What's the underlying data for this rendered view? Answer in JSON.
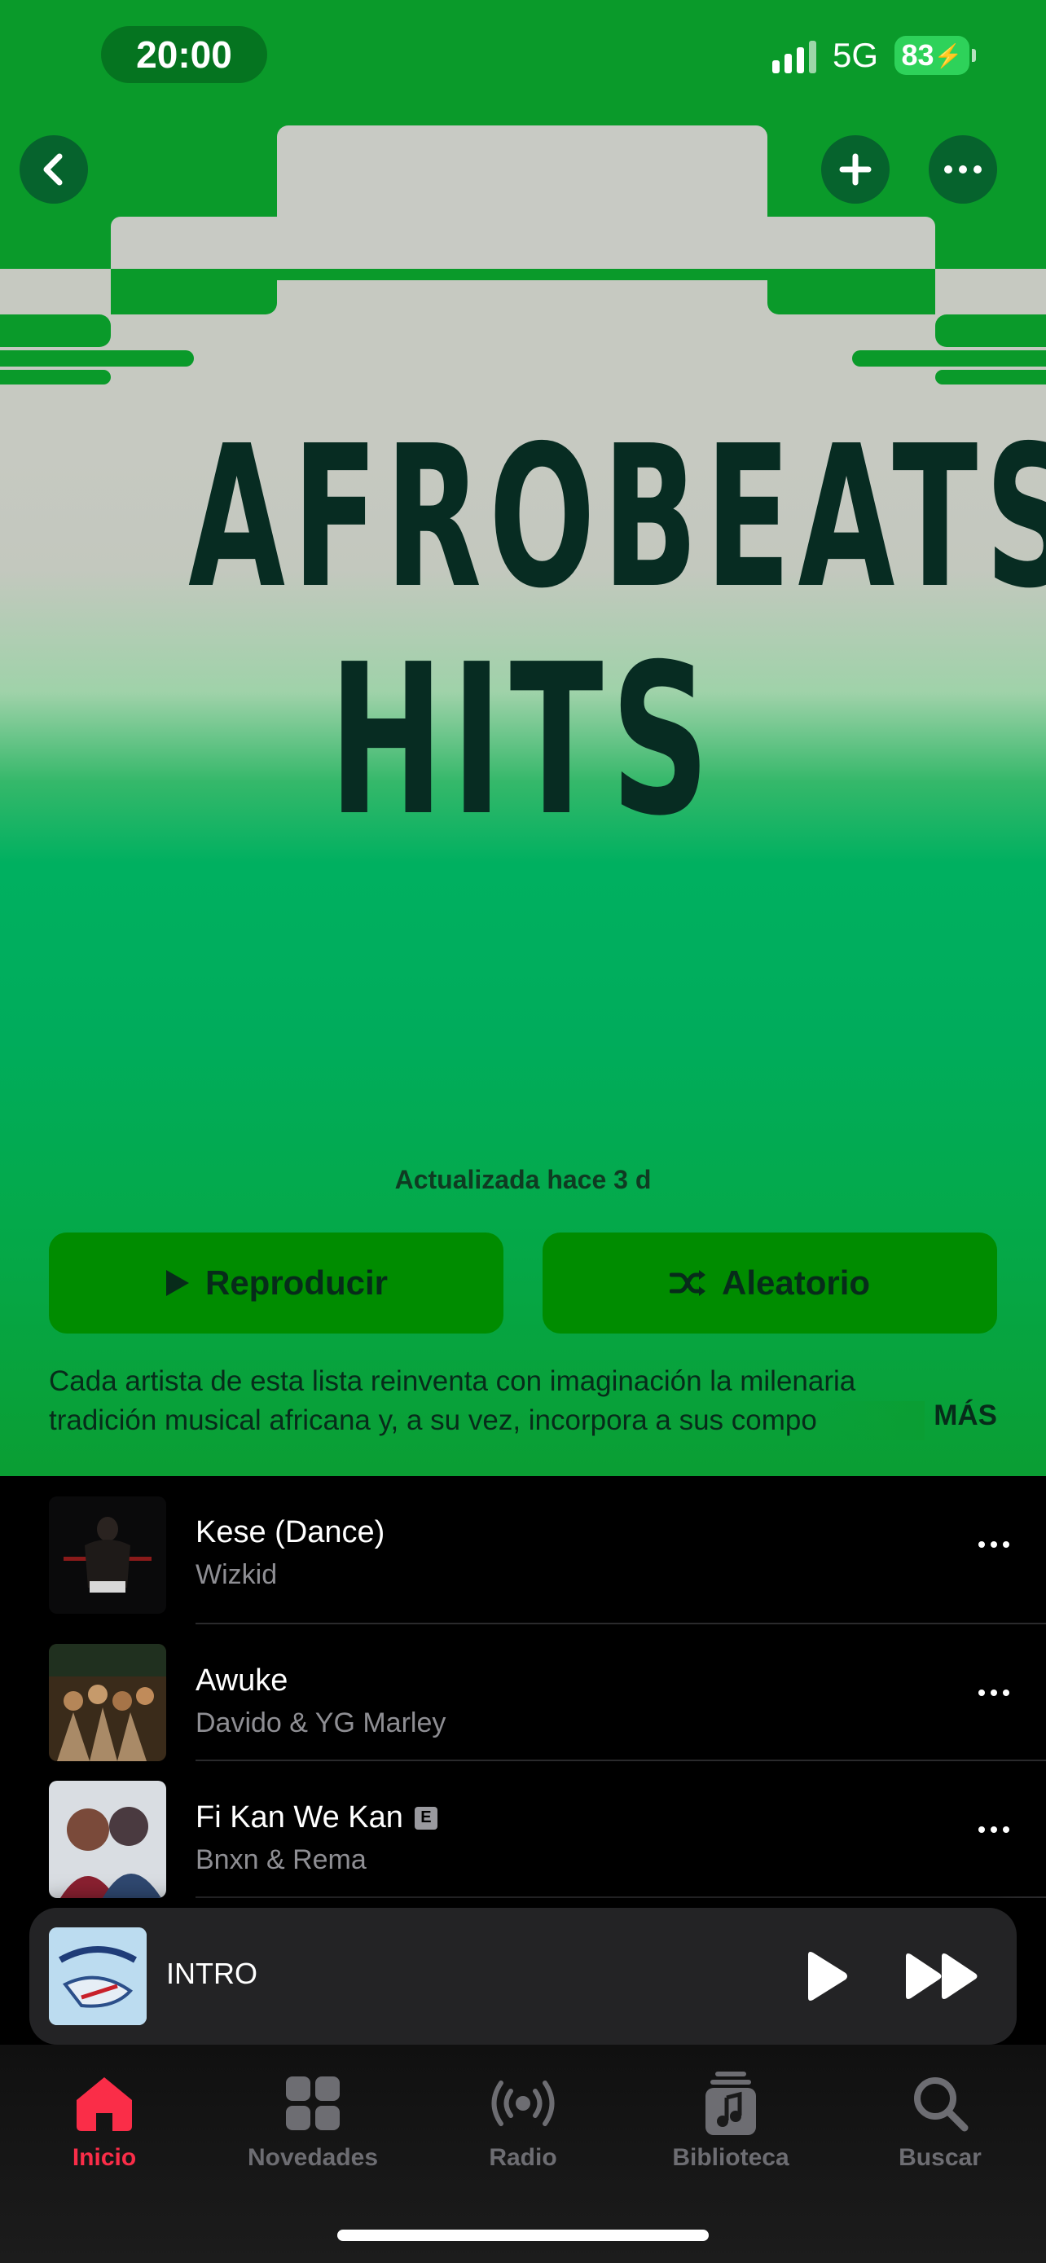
{
  "status_bar": {
    "time": "20:00",
    "network": "5G",
    "battery": "83"
  },
  "playlist": {
    "cover_title_line1": "AFROBEATS",
    "cover_title_line2": "HITS",
    "updated": "Actualizada hace 3 d",
    "play_label": "Reproducir",
    "shuffle_label": "Aleatorio",
    "description_line1": "Cada artista de esta lista reinventa con imaginación la milenaria",
    "description_line2": "tradición musical africana y, a su vez, incorpora a sus compo",
    "more_label": "MÁS"
  },
  "tracks": [
    {
      "title": "Kese (Dance)",
      "artist": "Wizkid",
      "explicit": false
    },
    {
      "title": "Awuke",
      "artist": "Davido & YG Marley",
      "explicit": false
    },
    {
      "title": "Fi Kan We Kan",
      "artist": "Bnxn & Rema",
      "explicit": true,
      "explicit_badge": "E"
    }
  ],
  "now_playing": {
    "title": "INTRO"
  },
  "tabs": [
    {
      "label": "Inicio",
      "icon": "home-icon",
      "active": true
    },
    {
      "label": "Novedades",
      "icon": "grid-icon",
      "active": false
    },
    {
      "label": "Radio",
      "icon": "radio-icon",
      "active": false
    },
    {
      "label": "Biblioteca",
      "icon": "library-icon",
      "active": false
    },
    {
      "label": "Buscar",
      "icon": "search-icon",
      "active": false
    }
  ],
  "colors": {
    "accent": "#fa2d48",
    "hero_green": "#00b060",
    "button_green": "#008c00",
    "cover_text": "#072c22",
    "cover_grey": "#c6c9c1"
  }
}
